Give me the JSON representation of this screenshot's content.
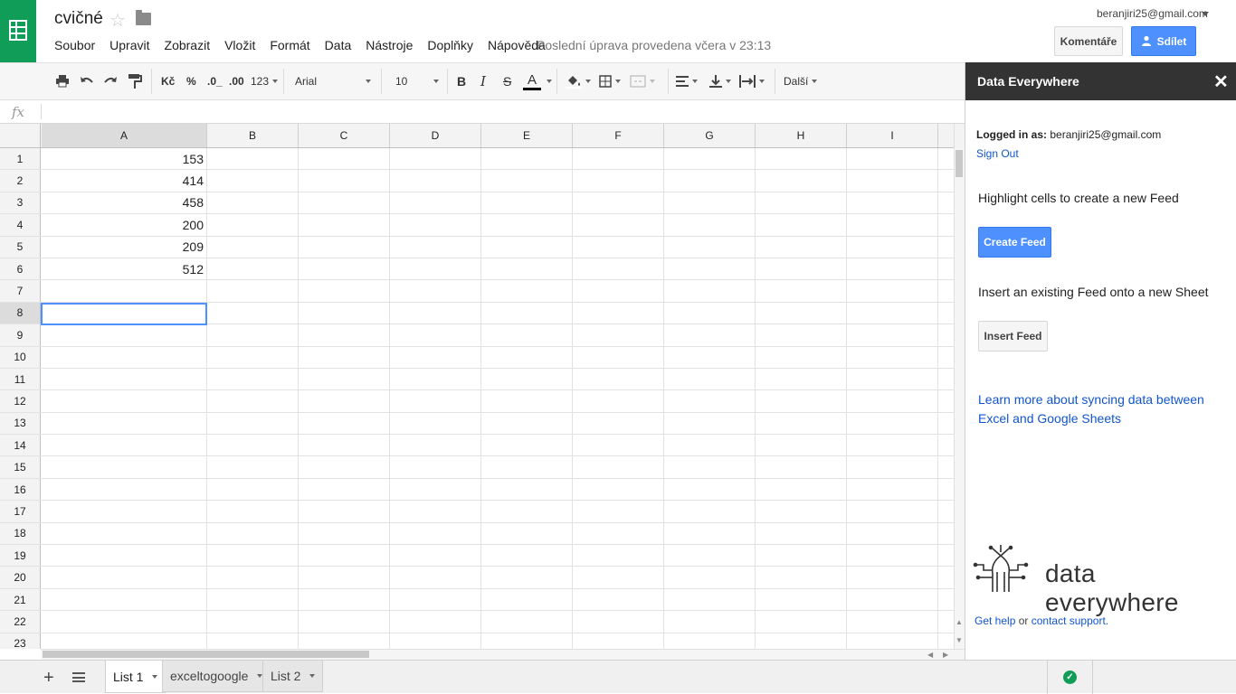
{
  "document": {
    "title": "cvičné",
    "last_edit": "Poslední úprava provedena včera v 23:13"
  },
  "menu": [
    "Soubor",
    "Upravit",
    "Zobrazit",
    "Vložit",
    "Formát",
    "Data",
    "Nástroje",
    "Doplňky",
    "Nápověda"
  ],
  "account": {
    "email": "beranjiri25@gmail.com",
    "comments_label": "Komentáře",
    "share_label": "Sdílet"
  },
  "toolbar": {
    "currency": "Kč",
    "percent": "%",
    "decrease_decimals": ".0_",
    "increase_decimals": ".00",
    "more_formats": "123",
    "font": "Arial",
    "font_size": "10",
    "bold": "B",
    "italic": "I",
    "strike": "S",
    "text_color": "A",
    "more": "Další"
  },
  "formula_bar": {
    "fx": "fx",
    "value": ""
  },
  "grid": {
    "columns": [
      "A",
      "B",
      "C",
      "D",
      "E",
      "F",
      "G",
      "H",
      "I"
    ],
    "rows": [
      "1",
      "2",
      "3",
      "4",
      "5",
      "6",
      "7",
      "8",
      "9",
      "10",
      "11",
      "12",
      "13",
      "14",
      "15",
      "16",
      "17",
      "18",
      "19",
      "20",
      "21",
      "22",
      "23"
    ],
    "column_a": [
      "153",
      "414",
      "458",
      "200",
      "209",
      "512",
      "",
      "",
      "",
      "",
      "",
      "",
      "",
      "",
      "",
      "",
      "",
      "",
      "",
      "",
      "",
      "",
      ""
    ],
    "selected_cell": "A8"
  },
  "sheets": {
    "tabs": [
      "List 1",
      "exceltogoogle",
      "List 2"
    ],
    "active": "List 1"
  },
  "sidebar": {
    "title": "Data Everywhere",
    "logged_in_label": "Logged in as:",
    "logged_in_email": "beranjiri25@gmail.com",
    "sign_out": "Sign Out",
    "highlight_text": "Highlight cells to create a new Feed",
    "create_feed": "Create Feed",
    "insert_text": "Insert an existing Feed onto a new Sheet",
    "insert_feed": "Insert Feed",
    "learn_more": "Learn more about syncing data between Excel and Google Sheets",
    "logo_text": "data everywhere",
    "help_prefix": "Get help",
    "help_or": "or",
    "help_link": "contact support."
  },
  "colors": {
    "sheets_green": "#0f9d58",
    "accent_blue": "#4d90fe",
    "link_blue": "#1155cc",
    "sidebar_header": "#333333"
  },
  "icons": [
    "sheets-logo-icon",
    "star-icon",
    "folder-icon",
    "print-icon",
    "undo-icon",
    "redo-icon",
    "paint-format-icon",
    "fill-color-icon",
    "borders-icon",
    "merge-icon",
    "align-icon",
    "valign-icon",
    "wrap-icon",
    "close-icon",
    "add-sheet-icon",
    "all-sheets-icon",
    "saved-check-icon",
    "data-everywhere-logo-icon"
  ]
}
